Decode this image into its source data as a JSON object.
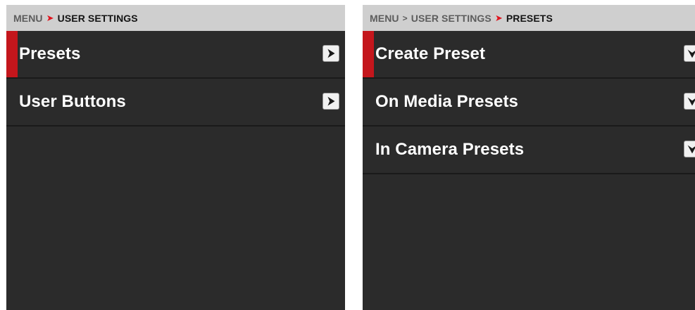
{
  "left_panel": {
    "breadcrumb": {
      "parent": "MENU",
      "current": "USER SETTINGS"
    },
    "items": [
      {
        "label": "Presets",
        "selected": true,
        "icon": "chevron-right-icon"
      },
      {
        "label": "User Buttons",
        "selected": false,
        "icon": "chevron-right-icon"
      }
    ]
  },
  "right_panel": {
    "breadcrumb": {
      "root": "MENU",
      "parent": "USER SETTINGS",
      "current": "PRESETS"
    },
    "items": [
      {
        "label": "Create Preset",
        "selected": true,
        "icon": "chevron-down-icon"
      },
      {
        "label": "On Media Presets",
        "selected": false,
        "icon": "chevron-down-icon"
      },
      {
        "label": "In Camera Presets",
        "selected": false,
        "icon": "chevron-down-icon"
      }
    ]
  },
  "colors": {
    "panel_background": "#2b2b2b",
    "header_background": "#cfcfcf",
    "accent_red": "#c4161c",
    "separator_red": "#e0141e",
    "text_white": "#ffffff"
  }
}
